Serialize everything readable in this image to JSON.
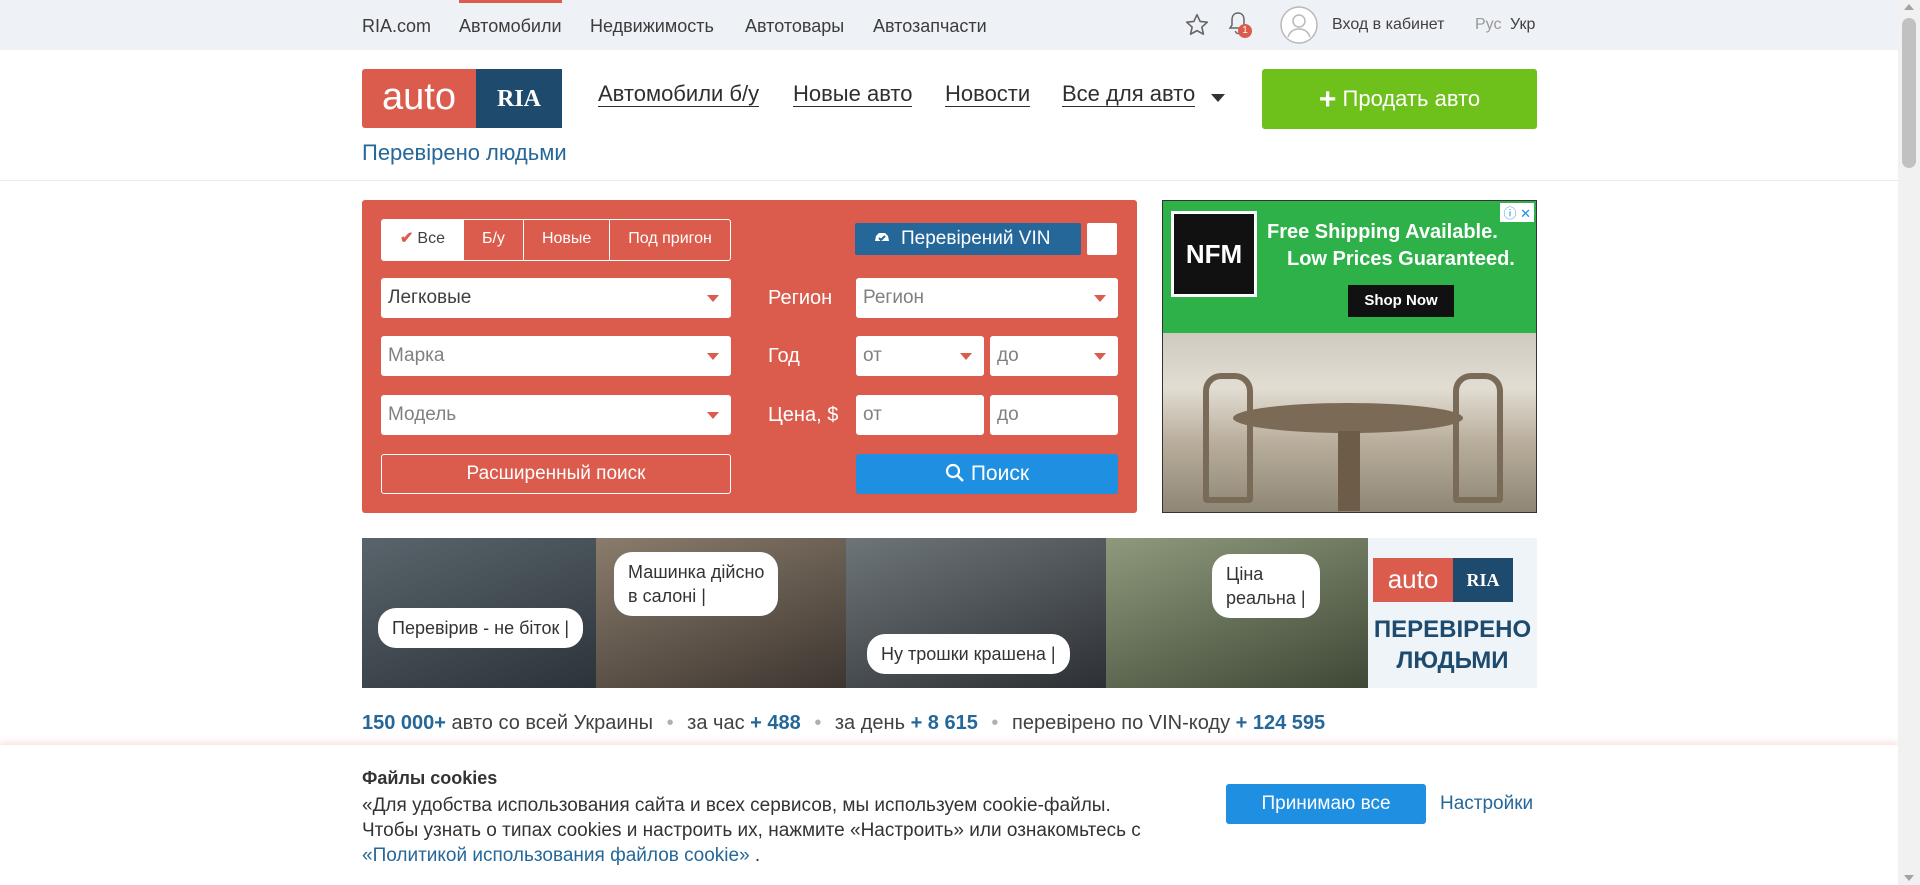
{
  "topbar": {
    "links": [
      "RIA.com",
      "Автомобили",
      "Недвижимость",
      "Автотовары",
      "Автозапчасти"
    ],
    "notification_count": "1",
    "login": "Вход в кабинет",
    "lang_ru": "Рус",
    "lang_uk": "Укр"
  },
  "header": {
    "logo_auto": "auto",
    "logo_ria": "RIA",
    "tagline": "Перевірено людьми",
    "nav": [
      "Автомобили б/у",
      "Новые авто",
      "Новости",
      "Все для авто"
    ],
    "sell_button": "Продать авто"
  },
  "search": {
    "tabs": [
      "Все",
      "Б/у",
      "Новые",
      "Под пригон"
    ],
    "vin_label": "Перевірений VIN",
    "type_value": "Легковые",
    "brand_placeholder": "Марка",
    "model_placeholder": "Модель",
    "region_label": "Регион",
    "region_placeholder": "Регион",
    "year_label": "Год",
    "year_from": "от",
    "year_to": "до",
    "price_label": "Цена, $",
    "price_from": "от",
    "price_to": "до",
    "advanced_button": "Расширенный поиск",
    "search_button": "Поиск"
  },
  "ad": {
    "brand": "NFM",
    "line1": "Free Shipping Available.",
    "line2": "Low Prices Guaranteed.",
    "cta": "Shop Now"
  },
  "banner": {
    "bubble1": "Перевірив - не біток |",
    "bubble2a": "Машинка дійсно",
    "bubble2b": "в салоні |",
    "bubble3": "Ну трошки крашена |",
    "bubble4a": "Ціна",
    "bubble4b": "реальна |",
    "logo_auto": "auto",
    "logo_ria": "RIA",
    "logo_text1": "ПЕРЕВІРЕНО",
    "logo_text2": "ЛЮДЬМИ"
  },
  "stats": {
    "total": "150 000+",
    "total_text": "авто со всей Украины",
    "hour_text": "за час",
    "hour_value": "+ 488",
    "day_text": "за день",
    "day_value": "+ 8 615",
    "vin_text": "перевірено по VIN-коду",
    "vin_value": "+ 124 595"
  },
  "cookie": {
    "title": "Файлы cookies",
    "line1": "«Для удобства использования сайта и всех сервисов, мы используем cookie-файлы.",
    "line2": "Чтобы узнать о типах cookies и настроить их, нажмите «Настроить» или ознакомьтесь с",
    "link": "«Политикой использования файлов cookie»",
    "link_tail": " .",
    "accept": "Принимаю все",
    "settings": "Настройки"
  },
  "colors": {
    "brand_red": "#db5c4c",
    "brand_blue": "#1d4a6d",
    "link_blue": "#256799",
    "sell_green": "#6ec01b",
    "button_blue": "#1e8fe1"
  }
}
